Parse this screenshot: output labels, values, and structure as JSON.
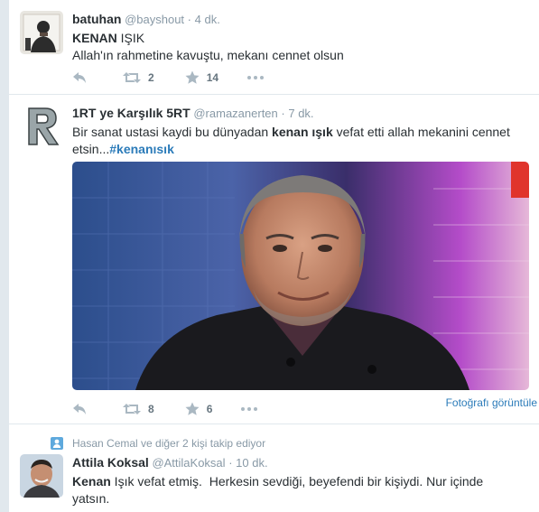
{
  "tweets": [
    {
      "name": "batuhan",
      "handle": "@bayshout",
      "sep": "·",
      "time": "4 dk.",
      "line1_bold": "KENAN",
      "line1_rest": " IŞIK",
      "line2": "Allah'ın rahmetine kavuştu, mekanı cennet olsun",
      "retweets": "2",
      "favorites": "14"
    },
    {
      "name": "1RT ye Karşılık 5RT",
      "handle": "@ramazanerten",
      "sep": "·",
      "time": "7 dk.",
      "text_pre": "Bir sanat ustasi kaydi bu dünyadan ",
      "text_bold": "kenan ışık",
      "text_mid": " vefat etti allah mekanini cennet etsin...",
      "hashtag": "#kenanısık",
      "photo_link": "Fotoğrafı görüntüle",
      "retweets": "8",
      "favorites": "6"
    },
    {
      "context": "Hasan Cemal ve diğer 2 kişi takip ediyor",
      "name": "Attila Koksal",
      "handle": "@AttilaKoksal",
      "sep": "·",
      "time": "10 dk.",
      "text_bold": "Kenan",
      "text_rest": " Işık vefat etmiş.  Herkesin sevdiği, beyefendi bir kişiydi. Nur içinde yatsın."
    }
  ],
  "colors": {
    "link": "#2b7bb9",
    "muted": "#8899a6",
    "text": "#292f33"
  },
  "icons": [
    "reply-icon",
    "retweet-icon",
    "favorite-icon",
    "more-icon",
    "follow-context-icon"
  ]
}
